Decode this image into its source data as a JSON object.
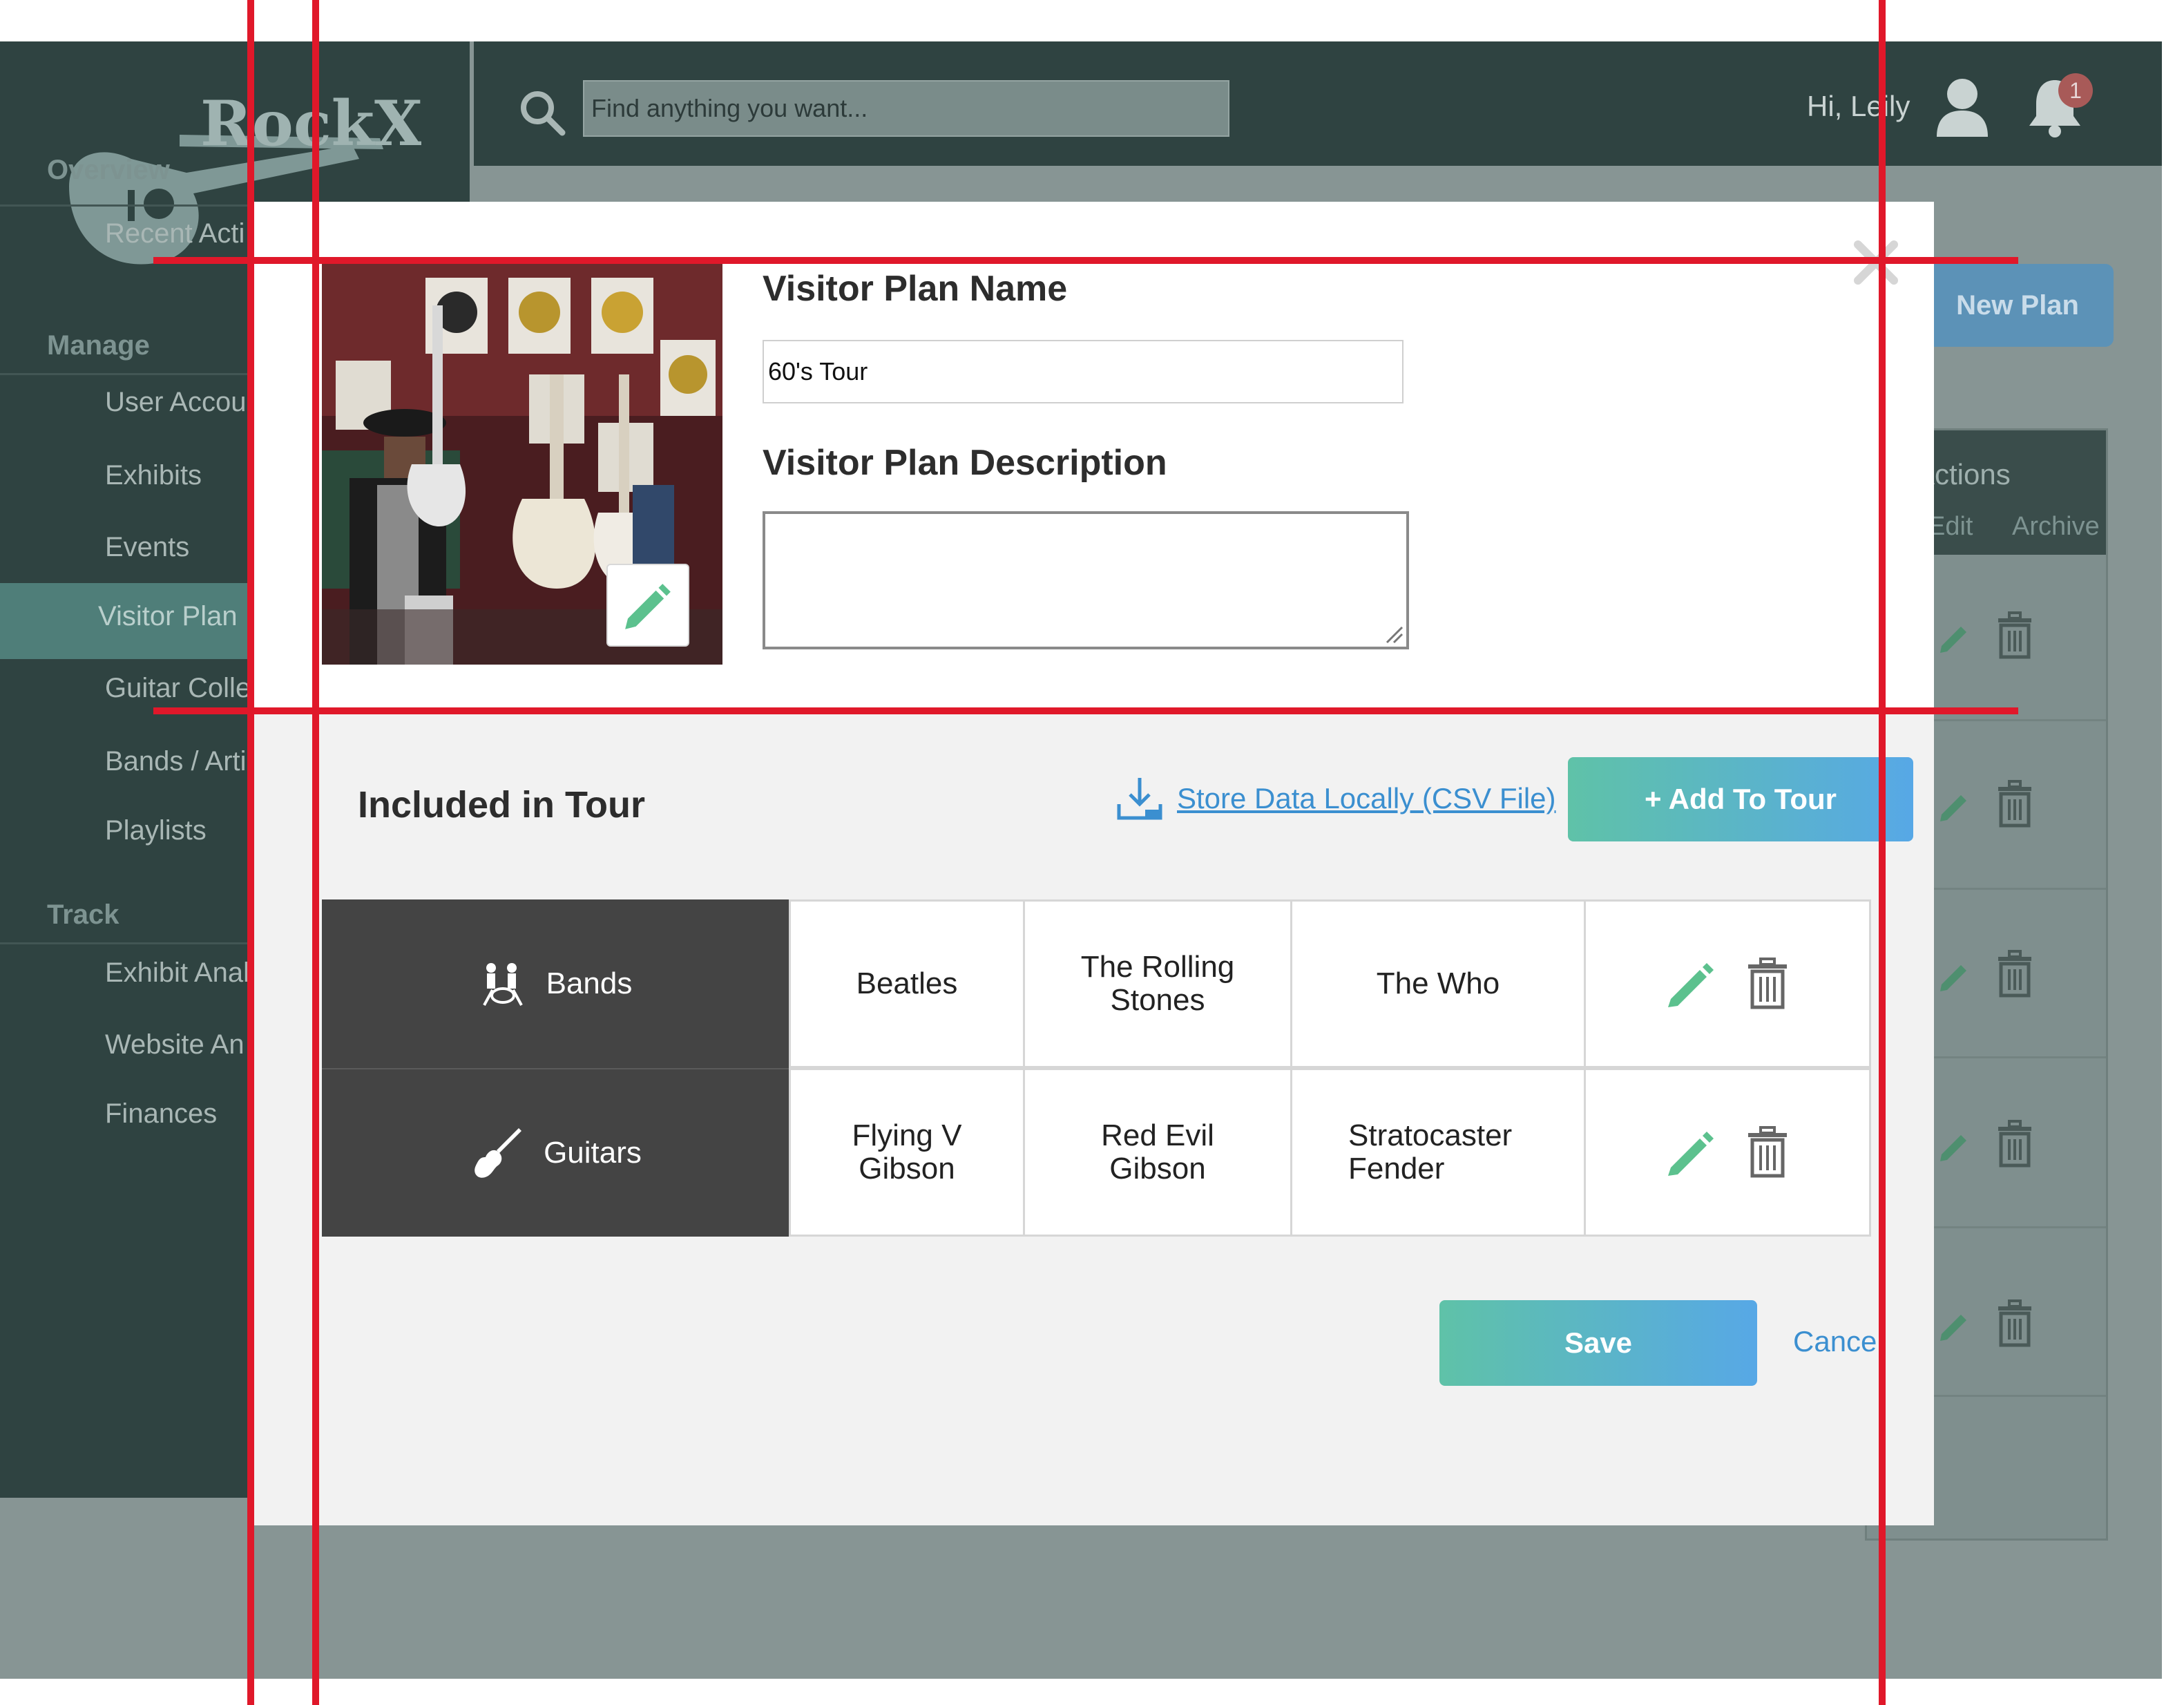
{
  "app": {
    "logo_text": "RockX",
    "search": {
      "placeholder": "Find anything you want..."
    },
    "greeting": "Hi, Leily",
    "notification_count": "1",
    "new_plan_button": "New Plan",
    "actions_header": "Actions",
    "actions_edit": "Edit",
    "actions_archive": "Archive"
  },
  "sidebar": {
    "sections": [
      {
        "title": "Overview",
        "items": [
          "Recent Acti"
        ]
      },
      {
        "title": "Manage",
        "items": [
          "User Accou",
          "Exhibits",
          "Events",
          "Visitor Plan",
          "Guitar Colle",
          "Bands / Arti",
          "Playlists"
        ]
      },
      {
        "title": "Track",
        "items": [
          "Exhibit Anal",
          "Website An",
          "Finances"
        ]
      }
    ],
    "active_item": "Visitor Plan"
  },
  "modal": {
    "name_label": "Visitor Plan Name",
    "name_value": "60's Tour",
    "description_label": "Visitor Plan Description",
    "description_value": "",
    "included_title": "Included in Tour",
    "store_link": "Store Data Locally (CSV File)",
    "add_button": "+ Add To Tour",
    "save_button": "Save",
    "cancel_link": "Cancel",
    "rows": [
      {
        "category": "Bands",
        "icon": "band-icon",
        "items": [
          "Beatles",
          "The Rolling Stones",
          "The Who"
        ]
      },
      {
        "category": "Guitars",
        "icon": "electric-guitar-icon",
        "items": [
          "Flying V Gibson",
          "Red Evil Gibson",
          "Stratocaster Fender"
        ]
      }
    ]
  },
  "colors": {
    "sidebar_bg": "#2f4341",
    "overlay_bg": "#879594",
    "accent_green": "#5fc2a8",
    "accent_blue": "#57a8e6",
    "link_blue": "#3b8fd0",
    "category_cell_bg": "#444444",
    "guide_red": "#e0182a"
  }
}
